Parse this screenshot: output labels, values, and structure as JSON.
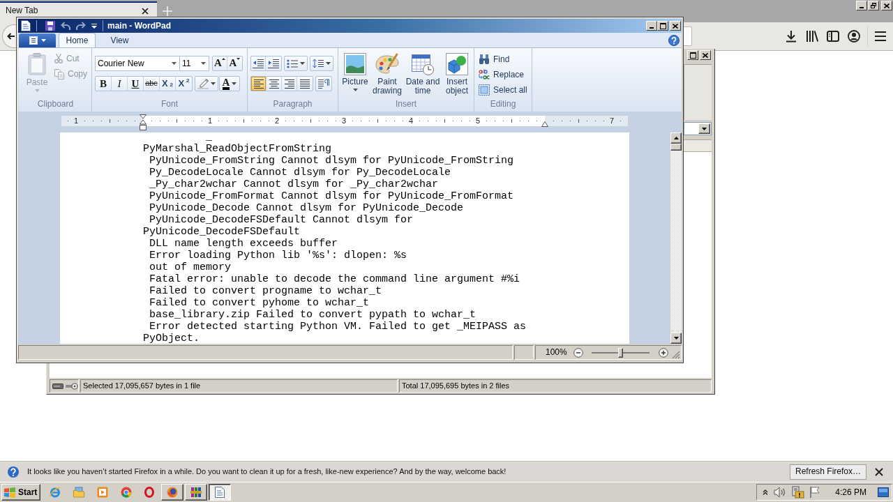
{
  "browser": {
    "tabs": [
      {
        "label": "New Tab",
        "selected": true
      }
    ]
  },
  "explorer": {
    "status_bar": [
      "Selected 17,095,657 bytes in 1 file",
      "Total 17,095,695 bytes in 2 files"
    ]
  },
  "wordpad": {
    "title": "main - WordPad",
    "ribbon_tabs": [
      {
        "label": "Home",
        "selected": true
      },
      {
        "label": "View",
        "selected": false
      }
    ],
    "clipboard": {
      "label": "Clipboard",
      "paste": {
        "label": "Paste",
        "disabled": true
      },
      "actions": [
        {
          "label": "Cut",
          "disabled": true
        },
        {
          "label": "Copy",
          "disabled": true
        }
      ]
    },
    "font": {
      "label": "Font",
      "family": "Courier New",
      "size": "11",
      "grow": "A",
      "shrink": "A",
      "styles": [
        {
          "kind": "bold",
          "label": "B"
        },
        {
          "kind": "italic",
          "label": "I"
        },
        {
          "kind": "underline",
          "label": "U"
        },
        {
          "kind": "strikethrough",
          "label": "abc"
        },
        {
          "kind": "subscript",
          "label": "X$_{2}$"
        },
        {
          "kind": "superscript",
          "label": "X$^{2}$"
        }
      ],
      "color_label": "A"
    },
    "paragraph": {
      "label": "Paragraph",
      "alignments": [
        {
          "selected": true
        },
        {
          "selected": false
        },
        {
          "selected": false
        },
        {
          "selected": false
        }
      ]
    },
    "insert": {
      "label": "Insert",
      "items": [
        {
          "label": "Picture",
          "dropdown": true
        },
        {
          "label": "Paint drawing",
          "dropdown": false
        },
        {
          "label": "Date and time",
          "dropdown": false
        },
        {
          "label": "Insert object",
          "dropdown": false
        }
      ]
    },
    "editing": {
      "label": "Editing",
      "items": [
        {
          "label": "Find"
        },
        {
          "label": "Replace"
        },
        {
          "label": "Select all"
        }
      ]
    },
    "ruler": [
      "1",
      "1",
      "2",
      "3",
      "4",
      "5",
      "7"
    ],
    "partial_line": "_",
    "document": [
      "PyMarshal_ReadObjectFromString",
      " PyUnicode_FromString Cannot dlsym for PyUnicode_FromString",
      " Py_DecodeLocale Cannot dlsym for Py_DecodeLocale",
      " _Py_char2wchar Cannot dlsym for _Py_char2wchar",
      " PyUnicode_FromFormat Cannot dlsym for PyUnicode_FromFormat",
      " PyUnicode_Decode Cannot dlsym for PyUnicode_Decode",
      " PyUnicode_DecodeFSDefault Cannot dlsym for",
      "PyUnicode_DecodeFSDefault",
      " DLL name length exceeds buffer",
      " Error loading Python lib '%s': dlopen: %s",
      " out of memory",
      " Fatal error: unable to decode the command line argument #%i",
      " Failed to convert progname to wchar_t",
      " Failed to convert pyhome to wchar_t",
      " base_library.zip Failed to convert pypath to wchar_t",
      " Error detected starting Python VM. Failed to get _MEIPASS as",
      "PyObject."
    ],
    "zoom": {
      "reading": "100%",
      "level": 0.5
    }
  },
  "notification": {
    "message": "It looks like you haven’t started Firefox in a while. Do you want to clean it up for a fresh, like-new experience? And by the way, welcome back!",
    "button": "Refresh Firefox…"
  },
  "taskbar": {
    "start": "Start",
    "tasks": [
      {
        "selected": false
      },
      {
        "selected": false
      },
      {
        "selected": true
      }
    ],
    "clock": "4:26 PM"
  }
}
